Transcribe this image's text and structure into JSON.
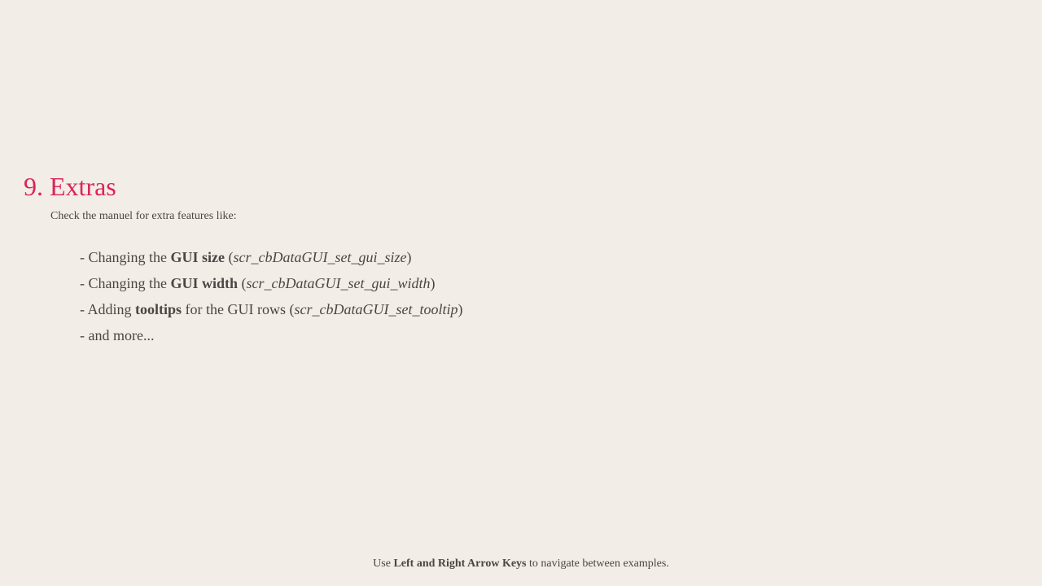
{
  "colors": {
    "background": "#f2ede7",
    "title": "#dc2459",
    "text": "#4a4643"
  },
  "section": {
    "title": "9. Extras",
    "intro": "Check the manuel for extra features like:"
  },
  "features": [
    {
      "prefix": "- Changing the ",
      "bold": "GUI size",
      "middle": " (",
      "italic": "scr_cbDataGUI_set_gui_size",
      "suffix": ")"
    },
    {
      "prefix": "- Changing the ",
      "bold": "GUI width",
      "middle": " (",
      "italic": "scr_cbDataGUI_set_gui_width",
      "suffix": ")"
    },
    {
      "prefix": "- Adding ",
      "bold": "tooltips",
      "middle": " for the GUI rows (",
      "italic": "scr_cbDataGUI_set_tooltip",
      "suffix": ")"
    },
    {
      "prefix": "- and more...",
      "bold": "",
      "middle": "",
      "italic": "",
      "suffix": ""
    }
  ],
  "footer": {
    "before": "Use ",
    "keys": "Left and Right Arrow Keys",
    "after": " to navigate between examples."
  }
}
